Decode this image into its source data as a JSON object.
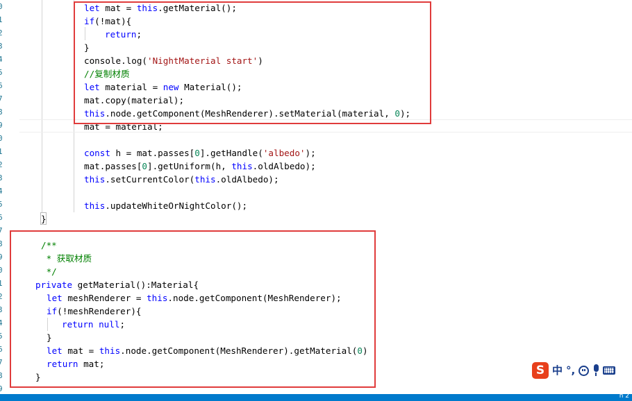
{
  "gutter": {
    "line_numbers": [
      "0",
      "1",
      "2",
      "3",
      "4",
      "5",
      "6",
      "7",
      "8",
      "9",
      "0",
      "1",
      "2",
      "3",
      "4",
      "5",
      "6",
      "7",
      "8",
      "9",
      "0",
      "1",
      "2",
      "3",
      "4",
      "5",
      "6",
      "7",
      "8",
      "9"
    ]
  },
  "code_block_1": {
    "line1": {
      "a": "let",
      "b": " mat = ",
      "c": "this",
      "d": ".getMaterial();"
    },
    "line2": {
      "a": "if",
      "b": "(!mat){"
    },
    "line3": {
      "a": "return",
      "b": ";"
    },
    "line4": {
      "a": "}"
    },
    "line5": {
      "a": "console.log(",
      "b": "'NightMaterial start'",
      "c": ")"
    },
    "line6": {
      "a": "//复制材质"
    },
    "line7": {
      "a": "let",
      "b": " material = ",
      "c": "new",
      "d": " Material();"
    },
    "line8": {
      "a": "mat.copy(material);"
    },
    "line9": {
      "a": "this",
      "b": ".node.getComponent(MeshRenderer).setMaterial(material, ",
      "c": "0",
      "d": ");"
    },
    "line10": {
      "a": "mat = material;"
    },
    "line11": {
      "a": "const",
      "b": " h = mat.passes[",
      "c": "0",
      "d": "].getHandle(",
      "e": "'albedo'",
      "f": ");"
    },
    "line12": {
      "a": "mat.passes[",
      "b": "0",
      "c": "].getUniform(h, ",
      "d": "this",
      "e": ".oldAlbedo);"
    },
    "line13": {
      "a": "this",
      "b": ".setCurrentColor(",
      "c": "this",
      "d": ".oldAlbedo);"
    },
    "line14": {
      "a": "this",
      "b": ".updateWhiteOrNightColor();"
    },
    "line15": {
      "a": "}"
    }
  },
  "code_block_2": {
    "line1": {
      "a": "/**"
    },
    "line2": {
      "a": " * 获取材质"
    },
    "line3": {
      "a": " */"
    },
    "line4": {
      "a": "private",
      "b": " getMaterial():Material{"
    },
    "line5": {
      "a": "let",
      "b": " meshRenderer = ",
      "c": "this",
      "d": ".node.getComponent(MeshRenderer);"
    },
    "line6": {
      "a": "if",
      "b": "(!meshRenderer){"
    },
    "line7": {
      "a": "return",
      "b": " ",
      "c": "null",
      "d": ";"
    },
    "line8": {
      "a": "}"
    },
    "line9": {
      "a": "let",
      "b": " mat = ",
      "c": "this",
      "d": ".node.getComponent(MeshRenderer).getMaterial(",
      "e": "0",
      "f": ")"
    },
    "line10": {
      "a": "return",
      "b": " mat;"
    },
    "line11": {
      "a": "}"
    }
  },
  "ime_toolbar": {
    "logo": "S",
    "mode": "中",
    "punct": "°,",
    "icons": [
      "emoji-icon",
      "microphone-icon",
      "keyboard-icon"
    ]
  },
  "status_bar": {
    "text": "n 2"
  },
  "colors": {
    "highlight_border": "#e03b3b",
    "keyword": "#0000ff",
    "string": "#a31515",
    "number": "#098658",
    "comment": "#008000",
    "status_bar": "#007acc"
  }
}
